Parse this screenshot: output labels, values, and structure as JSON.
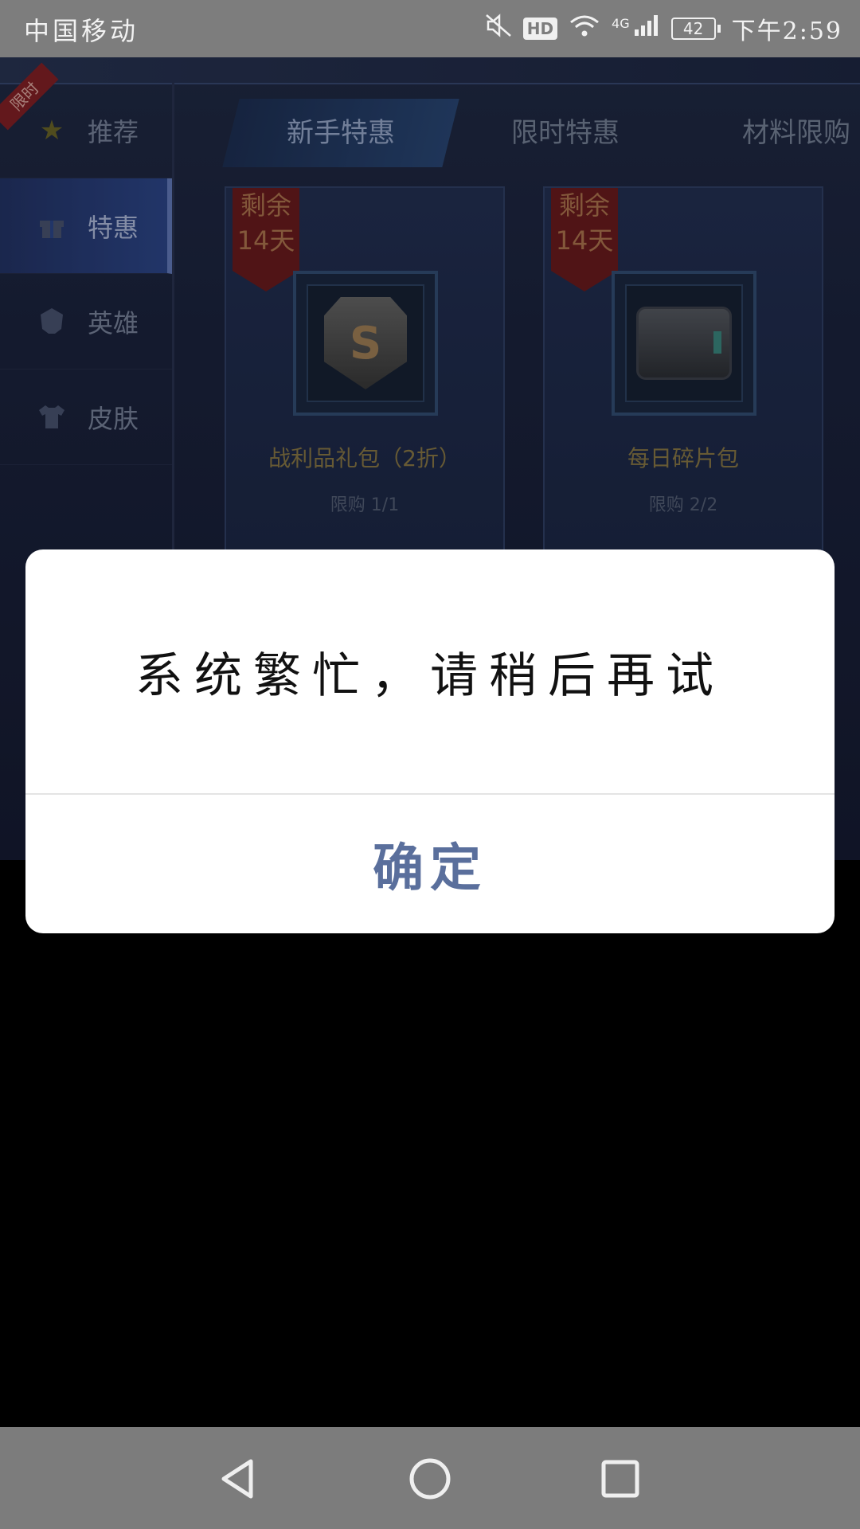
{
  "status_bar": {
    "carrier": "中国移动",
    "hd": "HD",
    "network": "4G",
    "battery": "42",
    "time": "下午2:59"
  },
  "game": {
    "limited_ribbon": "限时",
    "sidebar": [
      {
        "label": "推荐",
        "icon": "star-icon"
      },
      {
        "label": "特惠",
        "icon": "gift-icon",
        "active": true
      },
      {
        "label": "英雄",
        "icon": "helmet-icon"
      },
      {
        "label": "皮肤",
        "icon": "shirt-icon"
      }
    ],
    "tabs": [
      {
        "label": "新手特惠",
        "active": true
      },
      {
        "label": "限时特惠"
      },
      {
        "label": "材料限购"
      }
    ],
    "cards": [
      {
        "badge_line1": "剩余",
        "badge_line2": "14天",
        "title": "战利品礼包（2折）",
        "limit": "限购 1/1",
        "icon": "shield-s-icon"
      },
      {
        "badge_line1": "剩余",
        "badge_line2": "14天",
        "title": "每日碎片包",
        "limit": "限购 2/2",
        "icon": "chest-icon"
      }
    ]
  },
  "dialog": {
    "message": "系统繁忙，请稍后再试",
    "confirm_label": "确定"
  },
  "colors": {
    "dialog_confirm": "#5a6f9c",
    "status_bar_bg": "#7d7d7d",
    "nav_bar_bg": "#7c7c7c"
  }
}
